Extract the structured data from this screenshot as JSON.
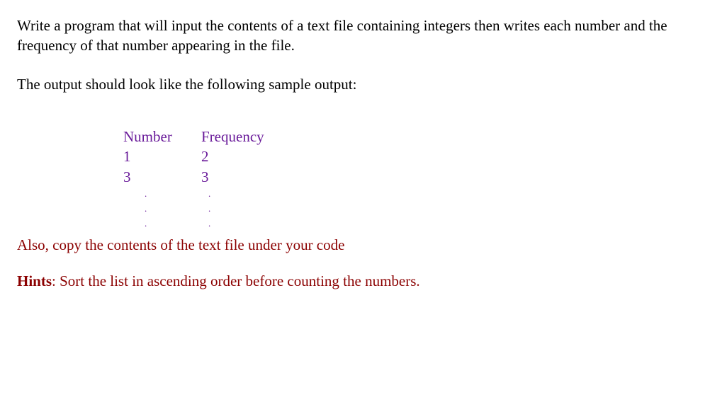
{
  "para1": "Write a program that will input the contents of a text file containing integers then writes each number and the frequency of that number appearing in the file.",
  "para2": "The output should look like the following sample output:",
  "table": {
    "header_number": "Number",
    "header_frequency": "Frequency",
    "rows": [
      {
        "number": "1",
        "frequency": "2"
      },
      {
        "number": "3",
        "frequency": "3"
      }
    ],
    "dot": "."
  },
  "para3": "Also, copy the contents of the text file under your code",
  "hints_label": "Hints",
  "hints_text": ": Sort the list in ascending order before counting the numbers."
}
